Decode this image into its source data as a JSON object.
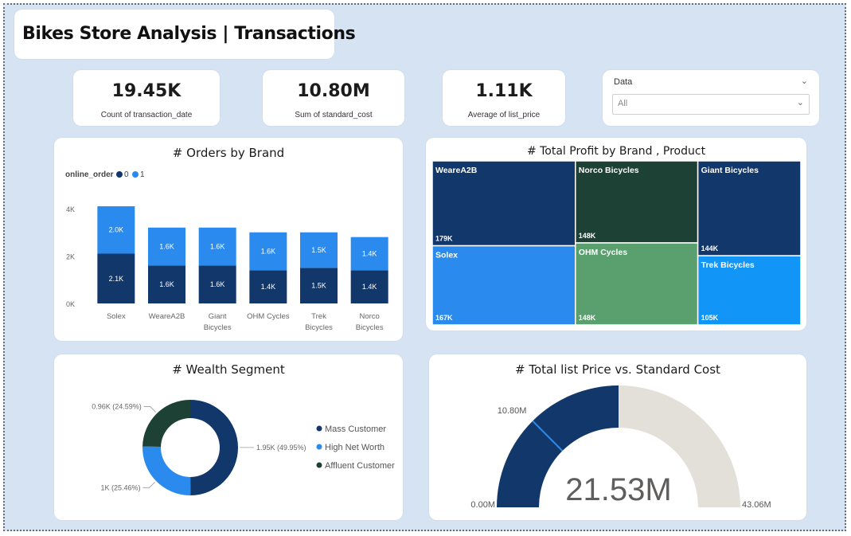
{
  "header": {
    "title": "Bikes Store Analysis | Transactions"
  },
  "kpis": [
    {
      "value": "19.45K",
      "label": "Count of transaction_date"
    },
    {
      "value": "10.80M",
      "label": "Sum of standard_cost"
    },
    {
      "value": "1.11K",
      "label": "Average of list_price"
    }
  ],
  "slicer": {
    "label": "Data",
    "selected": "All",
    "icon": "chevron-down-icon"
  },
  "colors": {
    "dark_navy": "#12376b",
    "blue": "#2b8aee",
    "dark_green": "#1e4136",
    "green": "#5a9f6e",
    "bright_blue": "#1196f7",
    "gauge_bg": "#e3dfd9",
    "frame_bg": "#d6e3f2"
  },
  "chart_data": [
    {
      "type": "bar",
      "stacked": true,
      "title": "# Orders by Brand",
      "legend_title": "online_order",
      "legend_position": "top-left",
      "categories": [
        "Solex",
        "WeareA2B",
        "Giant Bicycles",
        "OHM Cycles",
        "Trek Bicycles",
        "Norco Bicycles"
      ],
      "series": [
        {
          "name": "0",
          "values": [
            2.1,
            1.6,
            1.6,
            1.4,
            1.5,
            1.4
          ],
          "labels": [
            "2.1K",
            "1.6K",
            "1.6K",
            "1.4K",
            "1.5K",
            "1.4K"
          ],
          "color": "#12376b"
        },
        {
          "name": "1",
          "values": [
            2.0,
            1.6,
            1.6,
            1.6,
            1.5,
            1.4
          ],
          "labels": [
            "2.0K",
            "1.6K",
            "1.6K",
            "1.6K",
            "1.5K",
            "1.4K"
          ],
          "color": "#2b8aee"
        }
      ],
      "y_ticks": [
        "0K",
        "2K",
        "4K"
      ],
      "ylim": [
        0,
        4.2
      ],
      "grid": false
    },
    {
      "type": "treemap",
      "title": "# Total Profit by Brand , Product",
      "items": [
        {
          "name": "WeareA2B",
          "value": 179,
          "label": "179K",
          "color": "#12376b"
        },
        {
          "name": "Solex",
          "value": 167,
          "label": "167K",
          "color": "#2b8aee"
        },
        {
          "name": "Norco Bicycles",
          "value": 148,
          "label": "148K",
          "color": "#1e4136"
        },
        {
          "name": "OHM Cycles",
          "value": 148,
          "label": "148K",
          "color": "#5a9f6e"
        },
        {
          "name": "Giant Bicycles",
          "value": 144,
          "label": "144K",
          "color": "#12376b"
        },
        {
          "name": "Trek Bicycles",
          "value": 105,
          "label": "105K",
          "color": "#1196f7"
        }
      ]
    },
    {
      "type": "pie",
      "donut": true,
      "title": "# Wealth Segment",
      "legend_position": "right",
      "slices": [
        {
          "name": "Mass Customer",
          "value": 1.95,
          "percent": 49.95,
          "label": "1.95K (49.95%)",
          "color": "#12376b"
        },
        {
          "name": "High Net Worth",
          "value": 1.0,
          "percent": 25.46,
          "label": "1K (25.46%)",
          "color": "#2b8aee"
        },
        {
          "name": "Affluent Customer",
          "value": 0.96,
          "percent": 24.59,
          "label": "0.96K (24.59%)",
          "color": "#1e4136"
        }
      ]
    },
    {
      "type": "gauge",
      "title": "# Total list Price vs. Standard Cost",
      "value": 21.53,
      "value_label": "21.53M",
      "min": 0,
      "min_label": "0.00M",
      "max": 43.06,
      "max_label": "43.06M",
      "target": 10.8,
      "target_label": "10.80M"
    }
  ]
}
